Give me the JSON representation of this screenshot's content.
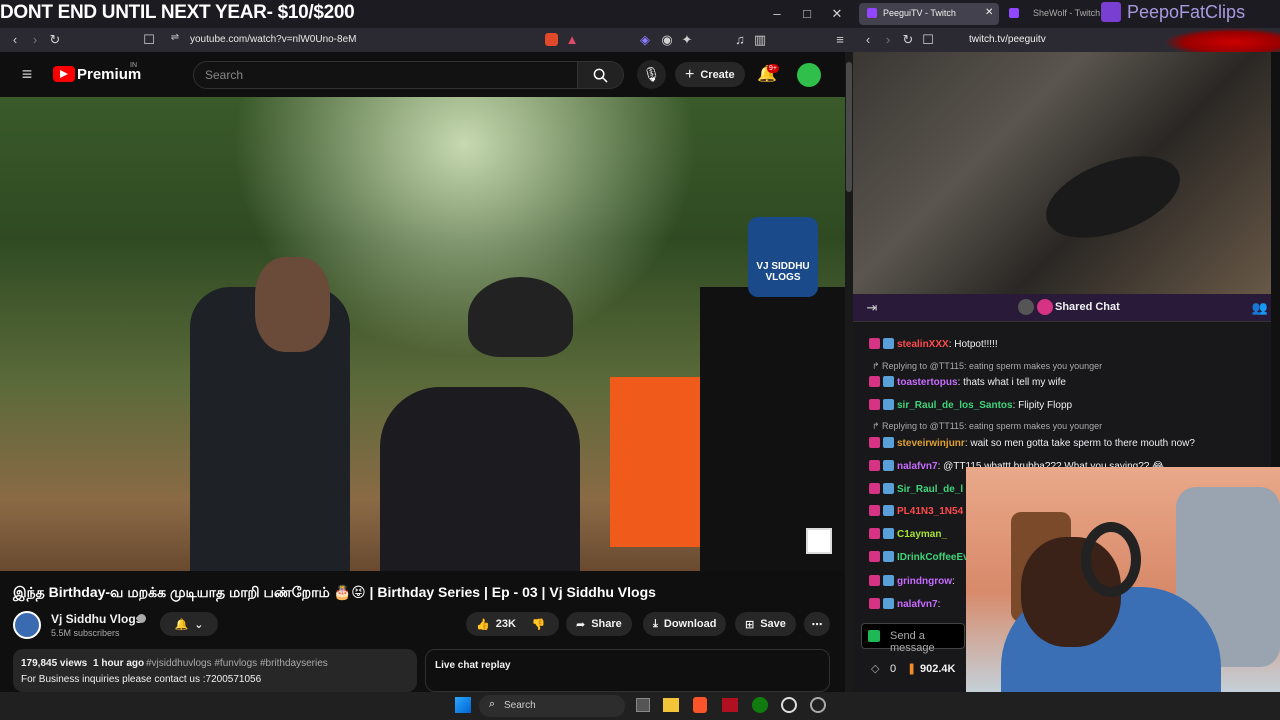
{
  "overlay": {
    "promo": "DONT END UNTIL NEXT YEAR- $10/$200",
    "brand": "PeepoFatClips"
  },
  "left_browser": {
    "url": "youtube.com/watch?v=nlW0Uno-8eM",
    "controls": {
      "min": "–",
      "max": "□",
      "close": "✕"
    }
  },
  "youtube": {
    "logo": "Premium",
    "logo_sup": "IN",
    "search_placeholder": "Search",
    "create": "Create",
    "notif_count": "9+",
    "video_watermark": "VJ SIDDHU\nVLOGS",
    "title": "இந்த Birthday-வ மறக்க முடியாத மாறி பண்றோம் 🎂😝 | Birthday Series | Ep - 03 | Vj Siddhu Vlogs",
    "channel": "Vj Siddhu Vlogs",
    "subscribers": "5.5M subscribers",
    "likes": "23K",
    "share": "Share",
    "download": "Download",
    "save": "Save",
    "views": "179,845 views",
    "time": "1 hour ago",
    "hashtags": "#vjsiddhuvlogs #funvlogs #brithdayseries",
    "desc": "For Business inquiries please contact us :7200571056",
    "live_chat": "Live chat replay"
  },
  "right_browser": {
    "tab1": "PeeguiTV - Twitch",
    "tab2": "SheWolf - Twitch",
    "url": "twitch.tv/peeguitv"
  },
  "twitch": {
    "shared_chat": "Shared Chat",
    "send_placeholder": "Send a message",
    "points_left": "0",
    "points_right": "902.4K",
    "chat": [
      {
        "user": "stealinXXX",
        "color": "#ff4b4b",
        "msg": ": Hotpot!!!!!"
      },
      {
        "reply": "Replying to @TT115: eating sperm makes you younger"
      },
      {
        "user": "toastertopus",
        "color": "#c76bff",
        "msg": ": thats what i tell my wife"
      },
      {
        "user": "sir_Raul_de_los_Santos",
        "color": "#3fd47a",
        "msg": ": Flipity Flopp"
      },
      {
        "reply": "Replying to @TT115: eating sperm makes you younger"
      },
      {
        "user": "steveirwinjunr",
        "color": "#e0a030",
        "msg": ": wait so men gotta take sperm to there mouth now?"
      },
      {
        "user": "nalafvn7",
        "color": "#c76bff",
        "msg": ": @TT115 whattt brubba??? What you saying?? 😂"
      },
      {
        "user": "Sir_Raul_de_l",
        "color": "#3fd47a",
        "msg": ""
      },
      {
        "user": "PL41N3_1N54",
        "color": "#ff4b4b",
        "msg": ""
      },
      {
        "user": "C1ayman_",
        "color": "#a6e22e",
        "msg": ""
      },
      {
        "user": "IDrinkCoffeeEve",
        "color": "#3fd47a",
        "msg": ""
      },
      {
        "user": "grindngrow",
        "color": "#c76bff",
        "msg": ":"
      },
      {
        "user": "nalafvn7",
        "color": "#c76bff",
        "msg": ":"
      }
    ]
  },
  "taskbar": {
    "search": "Search"
  },
  "colors": {
    "twitch": "#9147ff",
    "yt_red": "#ff0000",
    "accent_pink": "#d63384"
  }
}
